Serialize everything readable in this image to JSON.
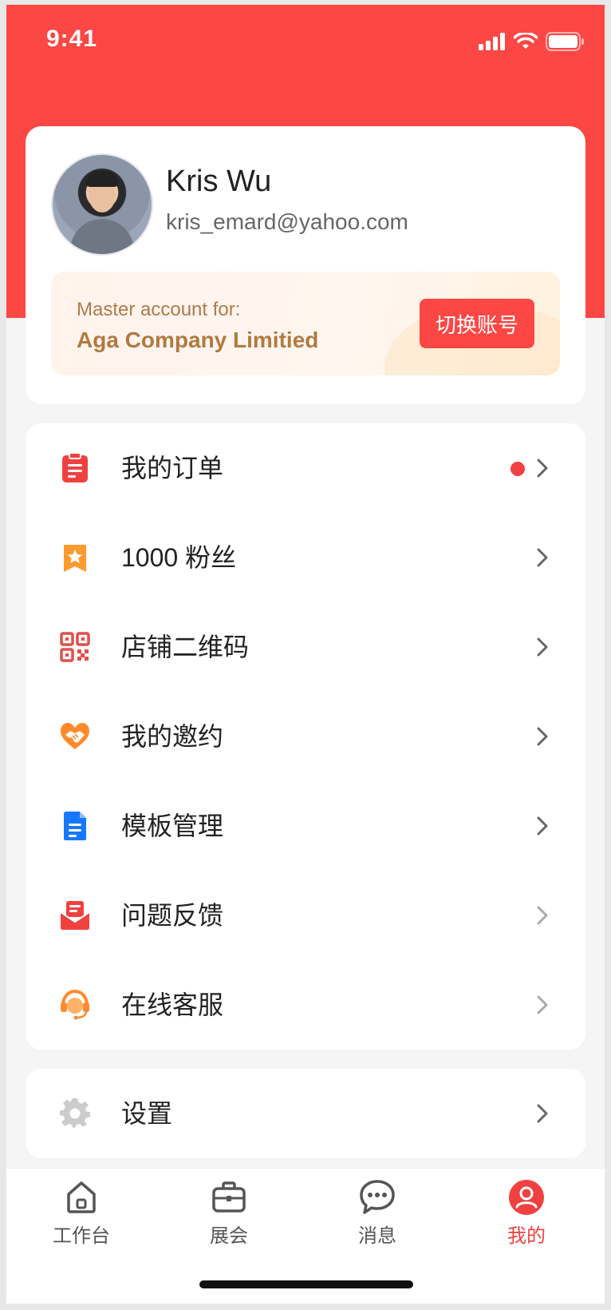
{
  "status_bar": {
    "time": "9:41"
  },
  "profile": {
    "name": "Kris Wu",
    "email": "kris_emard@yahoo.com",
    "master_label": "Master account for:",
    "company": "Aga Company Limitied",
    "switch_account": "切换账号"
  },
  "menu": {
    "items": [
      {
        "label": "我的订单",
        "icon": "order-icon",
        "badge": true,
        "color": "#f04141"
      },
      {
        "label": "1000 粉丝",
        "icon": "fans-star-icon",
        "color": "#ff9a2e"
      },
      {
        "label": "店铺二维码",
        "icon": "qr-code-icon",
        "color": "#e0504a"
      },
      {
        "label": "我的邀约",
        "icon": "handshake-icon",
        "color": "#ff8a2a"
      },
      {
        "label": "模板管理",
        "icon": "template-doc-icon",
        "color": "#1677ff"
      },
      {
        "label": "问题反馈",
        "icon": "feedback-mail-icon",
        "color": "#f04141"
      },
      {
        "label": "在线客服",
        "icon": "customer-service-icon",
        "color": "#ff8a2a"
      }
    ],
    "settings": {
      "label": "设置",
      "icon": "gear-icon",
      "color": "#cccccc"
    }
  },
  "tabbar": {
    "tabs": [
      {
        "label": "工作台",
        "icon": "home-icon"
      },
      {
        "label": "展会",
        "icon": "briefcase-icon"
      },
      {
        "label": "消息",
        "icon": "chat-icon"
      },
      {
        "label": "我的",
        "icon": "user-icon",
        "active": true
      }
    ]
  },
  "colors": {
    "brand": "#fc4744",
    "accent_gold": "#b07a40",
    "badge": "#f04141"
  }
}
